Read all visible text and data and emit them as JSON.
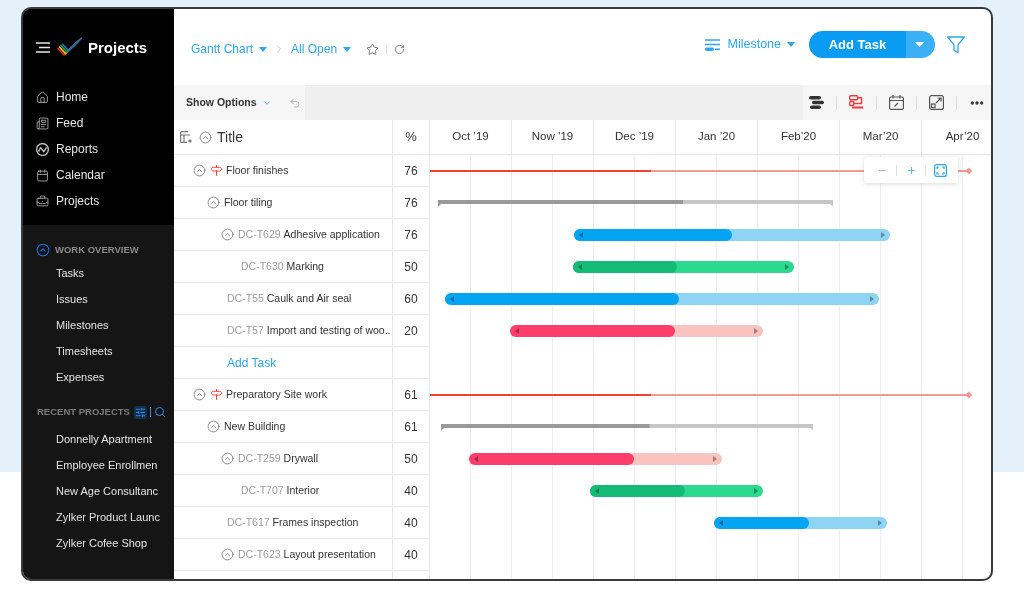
{
  "sidebar": {
    "app_name": "Projects",
    "nav": [
      {
        "label": "Home"
      },
      {
        "label": "Feed"
      },
      {
        "label": "Reports"
      },
      {
        "label": "Calendar"
      },
      {
        "label": "Projects"
      }
    ],
    "work_overview": {
      "title": "WORK OVERVIEW",
      "expanded": true,
      "items": [
        "Tasks",
        "Issues",
        "Milestones",
        "Timesheets",
        "Expenses"
      ]
    },
    "recent_projects": {
      "title": "RECENT PROJECTS",
      "items": [
        "Donnelly Apartment",
        "Employee Enrollmen",
        "New Age Consultanc",
        "Zylker Product Launc",
        "Zylker Cofee Shop"
      ]
    }
  },
  "header": {
    "breadcrumb": [
      {
        "label": "Gantt Chart"
      },
      {
        "label": "All Open"
      }
    ],
    "starred": false,
    "view_menu": {
      "label": "Milestone"
    },
    "add_button": {
      "label": "Add Task"
    }
  },
  "toolbar": {
    "show_options": {
      "label": "Show Options"
    }
  },
  "table": {
    "columns": [
      {
        "label": "Title"
      },
      {
        "label": "%"
      }
    ],
    "rows": [
      {
        "kind": "milestone",
        "title": "Floor finishes",
        "percent": "76",
        "expanded": true,
        "bar": {
          "level": 0.41,
          "color": "#f0432f",
          "track": {
            "color": "#f59a90"
          }
        },
        "children": [
          {
            "kind": "group",
            "title": "Floor tiling",
            "percent": "76",
            "expanded": true,
            "bar": {
              "level": 0.62,
              "color": "#9a9a9a",
              "track": {
                "color": "#c6c6c6"
              }
            },
            "children": [
              {
                "kind": "task",
                "id": "DC-T629",
                "title": "Adhesive application",
                "percent": "76",
                "expanded": true,
                "bar": {
                  "level": 0.5,
                  "color": "#03a4f1",
                  "track": {
                    "color": "#8ed5f4"
                  }
                },
                "children": [
                  {
                    "kind": "task",
                    "id": "DC-T630",
                    "title": "Marking",
                    "percent": "50",
                    "bar": {
                      "level": 0.47,
                      "color": "#14bb76",
                      "track": {
                        "color": "#2bd98f"
                      }
                    }
                  }
                ]
              },
              {
                "kind": "task",
                "id": "DC-T55",
                "title": "Caulk and Air seal",
                "percent": "60",
                "bar": {
                  "level": 0.54,
                  "color": "#03a4f1",
                  "track": {
                    "color": "#8ed5f4"
                  }
                }
              },
              {
                "kind": "task",
                "id": "DC-T57",
                "title": "Import and testing of woo..",
                "percent": "20",
                "bar": {
                  "level": 0.65,
                  "color": "#ff3d6c",
                  "track": {
                    "color": "#f9c3bf"
                  }
                }
              },
              {
                "kind": "add",
                "label": "Add Task"
              }
            ]
          }
        ]
      },
      {
        "kind": "milestone",
        "title": "Preparatory Site work",
        "percent": "61",
        "expanded": true,
        "bar": {
          "level": 0.41,
          "color": "#f0432f",
          "track": {
            "color": "#f59a90"
          }
        },
        "children": [
          {
            "kind": "group",
            "title": "New Building",
            "percent": "61",
            "expanded": true,
            "bar": {
              "level": 0.56,
              "color": "#9a9a9a",
              "track": {
                "color": "#c6c6c6"
              }
            },
            "children": [
              {
                "kind": "task",
                "id": "DC-T259",
                "title": "Drywall",
                "percent": "50",
                "expanded": true,
                "bar": {
                  "level": 0.65,
                  "color": "#ff3d6c",
                  "track": {
                    "color": "#f9c3bf"
                  }
                },
                "children": [
                  {
                    "kind": "task",
                    "id": "DC-T707",
                    "title": "Interior",
                    "percent": "40",
                    "bar": {
                      "level": 0.55,
                      "color": "#14bb76",
                      "track": {
                        "color": "#2bd98f"
                      }
                    }
                  }
                ]
              },
              {
                "kind": "task",
                "id": "DC-T617",
                "title": "Frames inspection",
                "percent": "40",
                "bar": {
                  "level": 0.55,
                  "color": "#03a4f1",
                  "track": {
                    "color": "#8ed5f4"
                  }
                }
              },
              {
                "kind": "task",
                "id": "DC-T623",
                "title": "Layout presentation",
                "percent": "40",
                "expanded": true
              }
            ]
          }
        ]
      }
    ]
  },
  "gantt": {
    "months": [
      "Oct ’19",
      "Now ’19",
      "Dec ’19",
      "Jan ’20",
      "Feb’20",
      "Mar’20",
      "Apr’20"
    ]
  }
}
